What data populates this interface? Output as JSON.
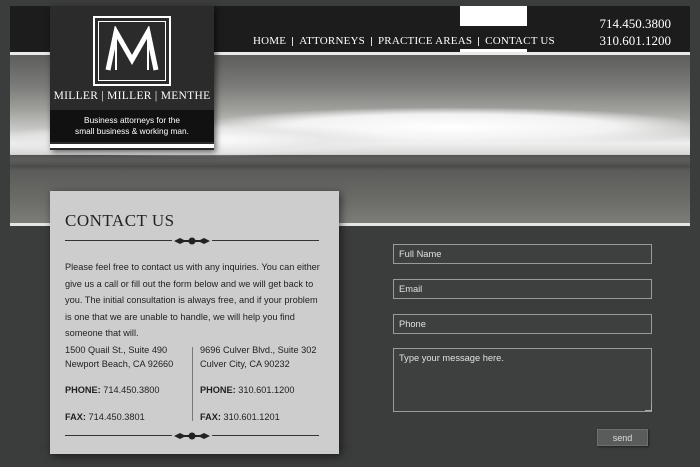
{
  "brand": {
    "name": "MILLER | MILLER | MENTHE",
    "tagline_line1": "Business attorneys for the",
    "tagline_line2": "small business & working man."
  },
  "nav": {
    "items": [
      {
        "label": "HOME"
      },
      {
        "label": "ATTORNEYS"
      },
      {
        "label": "PRACTICE AREAS"
      },
      {
        "label": "CONTACT US",
        "active": true
      }
    ]
  },
  "header": {
    "phone1": "714.450.3800",
    "phone2": "310.601.1200"
  },
  "contact": {
    "title": "CONTACT US",
    "intro": "Please feel free to contact us with any inquiries. You can either give us a call or fill out the form below and we will get back to you. The initial consultation is always free, and if your problem is one that we are unable to handle, we will help you find someone that will.",
    "offices": [
      {
        "street": "1500 Quail St., Suite 490",
        "city": "Newport Beach, CA 92660",
        "phone_label": "PHONE:",
        "phone": "714.450.3800",
        "fax_label": "FAX:",
        "fax": "714.450.3801"
      },
      {
        "street": "9696 Culver Blvd., Suite 302",
        "city": "Culver City, CA 90232",
        "phone_label": "PHONE:",
        "phone": "310.601.1200",
        "fax_label": "FAX:",
        "fax": "310.601.1201"
      }
    ]
  },
  "form": {
    "name_placeholder": "Full Name",
    "email_placeholder": "Email",
    "phone_placeholder": "Phone",
    "message_placeholder": "Type your message here.",
    "send_label": "send"
  },
  "colors": {
    "background": "#3b3c3c",
    "header": "#1c1c1c",
    "card": "#cdcdcd"
  }
}
